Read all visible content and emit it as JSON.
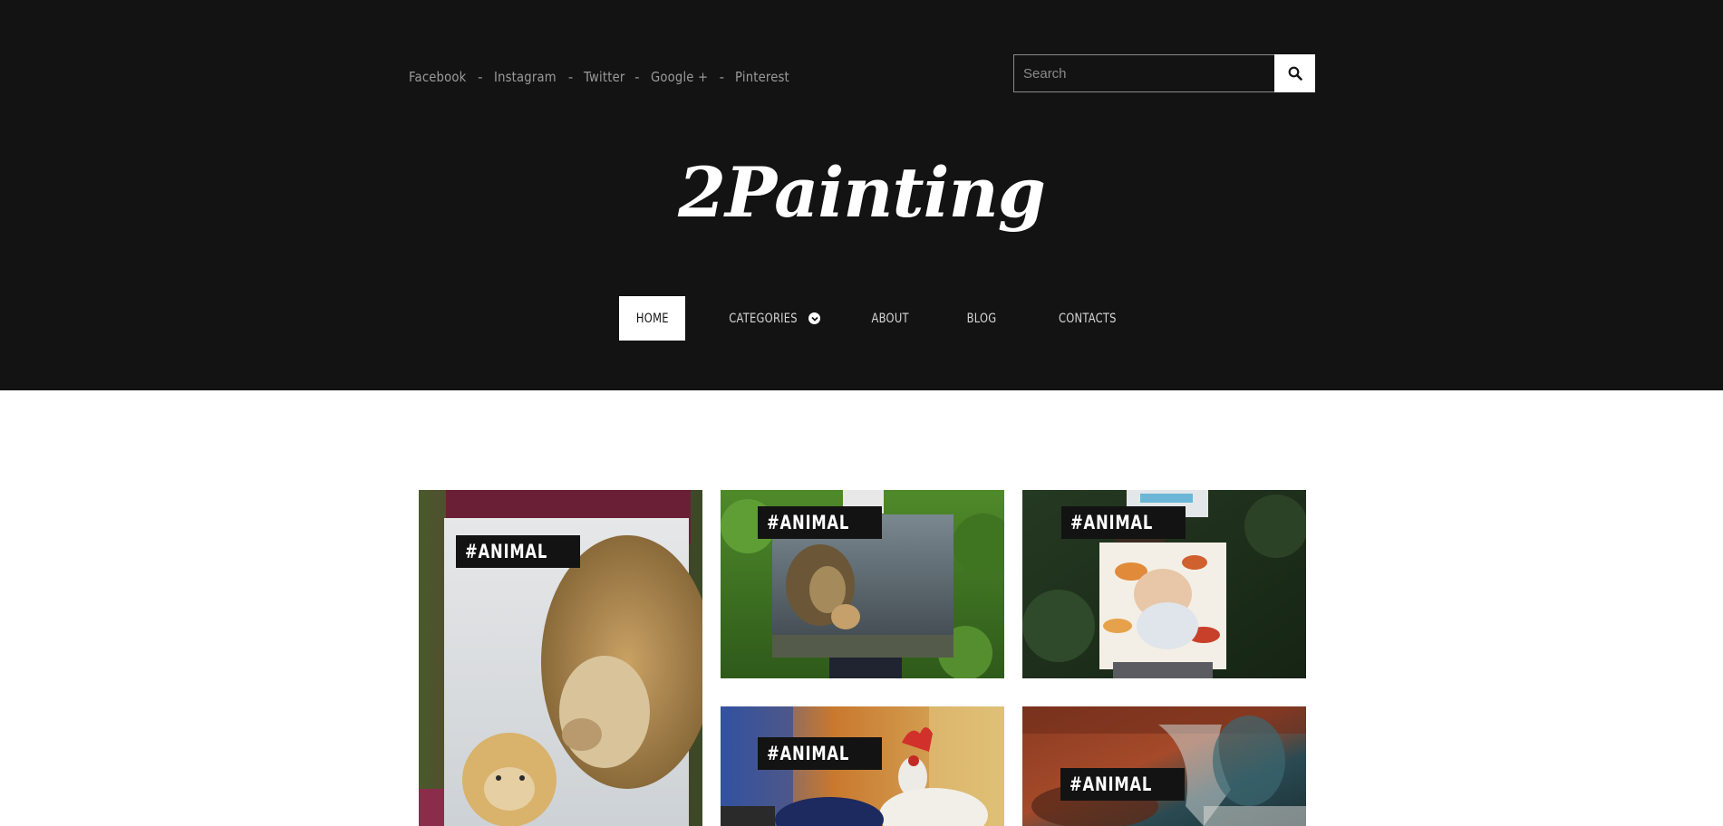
{
  "social": {
    "links": [
      "Facebook",
      "Instagram",
      "Twitter",
      "Google +",
      "Pinterest"
    ],
    "separator": "-"
  },
  "search": {
    "placeholder": "Search",
    "icon": "search-icon"
  },
  "site": {
    "logo": "2Painting"
  },
  "nav": {
    "items": [
      "HOME",
      "CATEGORIES",
      "ABOUT",
      "BLOG",
      "CONTACTS"
    ],
    "active": "HOME"
  },
  "gallery": {
    "cards": [
      {
        "tag": "#ANIMAL",
        "subject": "lion and cub painting"
      },
      {
        "tag": "#ANIMAL",
        "subject": "lion and cub on dark canvas"
      },
      {
        "tag": "#ANIMAL",
        "subject": "father and baby painting"
      },
      {
        "tag": "#ANIMAL",
        "subject": "rooster painting"
      },
      {
        "tag": "#ANIMAL",
        "subject": "abstract painting"
      }
    ]
  },
  "colors": {
    "header_bg": "#131313",
    "accent": "#ffffff",
    "text_muted": "#9a9a9a"
  }
}
